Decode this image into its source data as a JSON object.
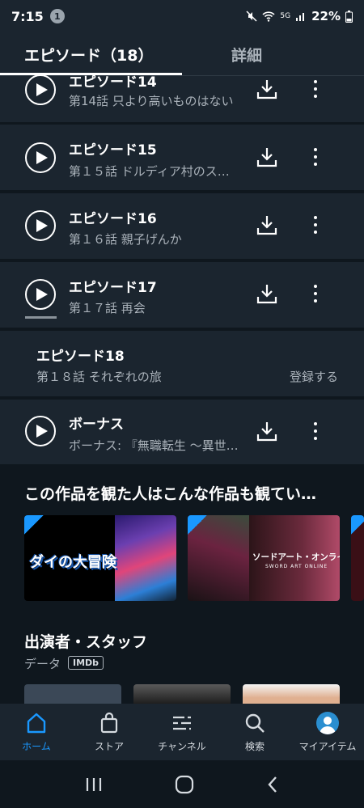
{
  "status": {
    "time": "7:15",
    "badge": "1",
    "battery": "22%",
    "signal_label": "5G"
  },
  "tabs": {
    "episodes": "エピソード（18）",
    "detail": "詳細"
  },
  "episodes": [
    {
      "title": "エピソード14",
      "subtitle": "第14話 只より高いものはない",
      "playable": true
    },
    {
      "title": "エピソード15",
      "subtitle": "第１５話 ドルディア村のス…",
      "playable": true
    },
    {
      "title": "エピソード16",
      "subtitle": "第１６話 親子げんか",
      "playable": true
    },
    {
      "title": "エピソード17",
      "subtitle": "第１７話 再会",
      "playable": true
    },
    {
      "title": "エピソード18",
      "subtitle": "第１８話 それぞれの旅",
      "playable": false,
      "action": "登録する"
    },
    {
      "title": "ボーナス",
      "subtitle": "ボーナス: 『無職転生 ～異世…",
      "playable": true
    }
  ],
  "recommend": {
    "title": "この作品を観た人はこんな作品も観てい…",
    "cards": [
      {
        "name": "ダイの大冒険",
        "badge": "prime"
      },
      {
        "name": "ソードアート・オンラインII",
        "subname": "SWORD ART ONLINE",
        "badge": "prime"
      }
    ]
  },
  "cast": {
    "title": "出演者・スタッフ",
    "data_label": "データ",
    "imdb": "IMDb"
  },
  "nav": [
    {
      "label": "ホーム",
      "icon": "home-icon"
    },
    {
      "label": "ストア",
      "icon": "shopping-bag-icon"
    },
    {
      "label": "チャンネル",
      "icon": "channels-icon"
    },
    {
      "label": "検索",
      "icon": "search-icon"
    },
    {
      "label": "マイアイテム",
      "icon": "avatar-icon"
    }
  ],
  "colors": {
    "background": "#0f171e",
    "panel": "#1b252f",
    "accent": "#1a98ff",
    "muted": "#aab2ba"
  }
}
